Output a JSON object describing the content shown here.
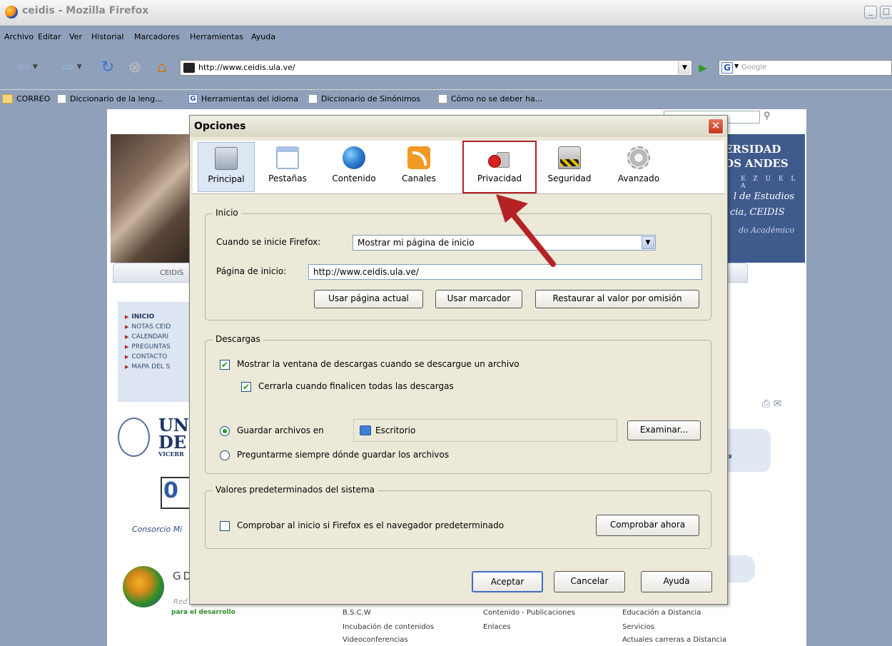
{
  "window": {
    "title": "ceidis - Mozilla Firefox",
    "controls": [
      "_",
      "□"
    ]
  },
  "menu": [
    "Archivo",
    "Editar",
    "Ver",
    "Historial",
    "Marcadores",
    "Herramientas",
    "Ayuda"
  ],
  "nav": {
    "url": "http://www.ceidis.ula.ve/",
    "search_placeholder": "Google",
    "search_engine_letter": "G"
  },
  "bookmarks": [
    {
      "label": "CORREO",
      "icon": "folder-icon"
    },
    {
      "label": "Diccionario de la leng...",
      "icon": "page-icon"
    },
    {
      "label": "Herramientas del idioma",
      "icon": "google-icon"
    },
    {
      "label": "Diccionario de Sinónimos",
      "icon": "page-icon"
    },
    {
      "label": "Cómo no se deber ha...",
      "icon": "page-icon"
    }
  ],
  "page": {
    "banner": {
      "line1": "ERSIDAD",
      "line2": "OS ANDES",
      "line3": "E Z U E L A",
      "line4": "l de Estudios",
      "line5": "cia, CEIDIS",
      "line6": "do Académico"
    },
    "tab_label": "CEIDIS",
    "sidenav": [
      "INICIO",
      "NOTAS CEID",
      "CALENDARI",
      "PREGUNTAS",
      "CONTACTO",
      "MAPA DEL S"
    ],
    "logo_un": "UN",
    "logo_de": "DE",
    "logo_vicerr": "VICERR",
    "logo_consorcio": "Consorcio Mi",
    "logo_gd": "GD",
    "logo_red": "Red",
    "logo_desarrollo": "para el desarrollo",
    "bluebox_text": "cias",
    "footer": {
      "col1": [
        "B.S.C.W",
        "Incubación de contenidos",
        "Videoconferencias"
      ],
      "col2": [
        "Contenido - Publicaciones",
        "Enlaces"
      ],
      "col3": [
        "Educación a Distancia",
        "Servicios",
        "Actuales carreras a Distancia"
      ]
    }
  },
  "dialog": {
    "title": "Opciones",
    "panes": [
      {
        "label": "Principal",
        "selected": true
      },
      {
        "label": "Pestañas"
      },
      {
        "label": "Contenido"
      },
      {
        "label": "Canales"
      },
      {
        "label": "Privacidad",
        "highlighted": true
      },
      {
        "label": "Seguridad"
      },
      {
        "label": "Avanzado"
      }
    ],
    "inicio": {
      "legend": "Inicio",
      "startup_label": "Cuando se inicie Firefox:",
      "startup_value": "Mostrar mi página de inicio",
      "homepage_label": "Página de inicio:",
      "homepage_value": "http://www.ceidis.ula.ve/",
      "btn_current": "Usar página actual",
      "btn_bookmark": "Usar marcador",
      "btn_restore": "Restaurar al valor por omisión"
    },
    "descargas": {
      "legend": "Descargas",
      "show_window": "Mostrar la ventana de descargas cuando se descargue un archivo",
      "close_when_done": "Cerrarla cuando finalicen todas las descargas",
      "save_to_label": "Guardar archivos en",
      "save_to_value": "Escritorio",
      "browse": "Examinar...",
      "ask_always": "Preguntarme siempre dónde guardar los archivos",
      "show_window_checked": true,
      "close_checked": true,
      "save_to_selected": true
    },
    "sistema": {
      "legend": "Valores predeterminados del sistema",
      "check_default": "Comprobar al inicio si Firefox es el navegador predeterminado",
      "check_now": "Comprobar ahora",
      "check_default_checked": false
    },
    "buttons": {
      "ok": "Aceptar",
      "cancel": "Cancelar",
      "help": "Ayuda"
    }
  },
  "colors": {
    "annotation_red": "#b52226",
    "dialog_bg": "#ece9d8",
    "check_green": "#21a121"
  }
}
